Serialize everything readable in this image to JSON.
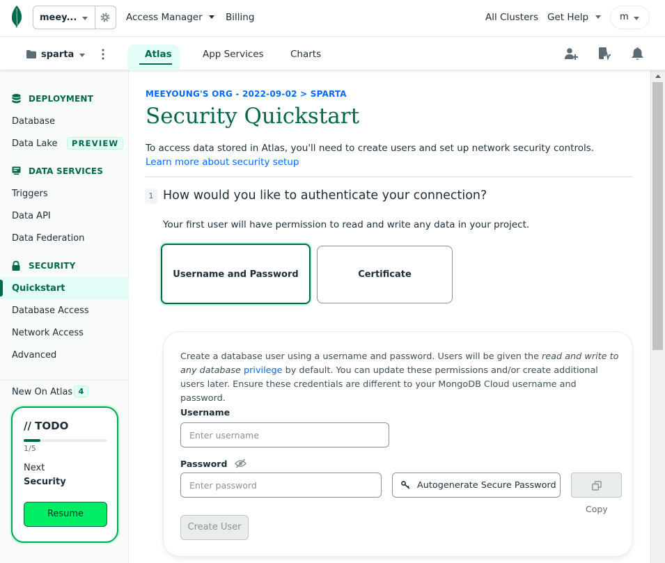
{
  "colors": {
    "brand_green": "#00684a",
    "accent_green": "#00ed64",
    "link_blue": "#016bf8",
    "active_bg": "#e3fcf7"
  },
  "topbar": {
    "org_name": "meey...",
    "nav": {
      "access_manager": "Access Manager",
      "billing": "Billing",
      "all_clusters": "All Clusters",
      "get_help": "Get Help"
    },
    "user_initial": "m"
  },
  "subbar": {
    "project_name": "sparta",
    "tabs": [
      {
        "label": "Atlas",
        "active": true
      },
      {
        "label": "App Services",
        "active": false
      },
      {
        "label": "Charts",
        "active": false
      }
    ],
    "icons": [
      "add-user-icon",
      "activity-icon",
      "bell-icon"
    ]
  },
  "sidebar": {
    "deployment": {
      "header": "DEPLOYMENT",
      "items": [
        "Database",
        "Data Lake"
      ],
      "preview_badge": "PREVIEW"
    },
    "data_services": {
      "header": "DATA SERVICES",
      "items": [
        "Triggers",
        "Data API",
        "Data Federation"
      ]
    },
    "security": {
      "header": "SECURITY",
      "items": [
        "Quickstart",
        "Database Access",
        "Network Access",
        "Advanced"
      ],
      "active": "Quickstart"
    },
    "new_on_atlas": {
      "label": "New On Atlas",
      "count": "4"
    },
    "todo": {
      "title": "// TODO",
      "progress": 0.2,
      "progress_text": "1/5",
      "next_label": "Next",
      "next_value": "Security",
      "resume": "Resume"
    }
  },
  "main": {
    "breadcrumb": "MEEYOUNG'S ORG - 2022-09-02 > SPARTA",
    "title": "Security Quickstart",
    "intro_text": "To access data stored in Atlas, you'll need to create users and set up network security controls.",
    "intro_link": "Learn more about security setup",
    "step_number": "1",
    "question": "How would you like to authenticate your connection?",
    "permission_note": "Your first user will have permission to read and write any data in your project.",
    "auth_options": [
      {
        "label": "Username and Password",
        "selected": true
      },
      {
        "label": "Certificate",
        "selected": false
      }
    ],
    "panel": {
      "desc_part1": "Create a database user using a username and password. Users will be given the ",
      "desc_italic": "read and write to any database",
      "desc_link": "privilege",
      "desc_part2": " by default. You can update these permissions and/or create additional users later. Ensure these credentials are different to your MongoDB Cloud username and password.",
      "username_label": "Username",
      "username_placeholder": "Enter username",
      "password_label": "Password",
      "password_placeholder": "Enter password",
      "autogenerate": "Autogenerate Secure Password",
      "copy_label": "Copy",
      "create_user": "Create User"
    }
  }
}
